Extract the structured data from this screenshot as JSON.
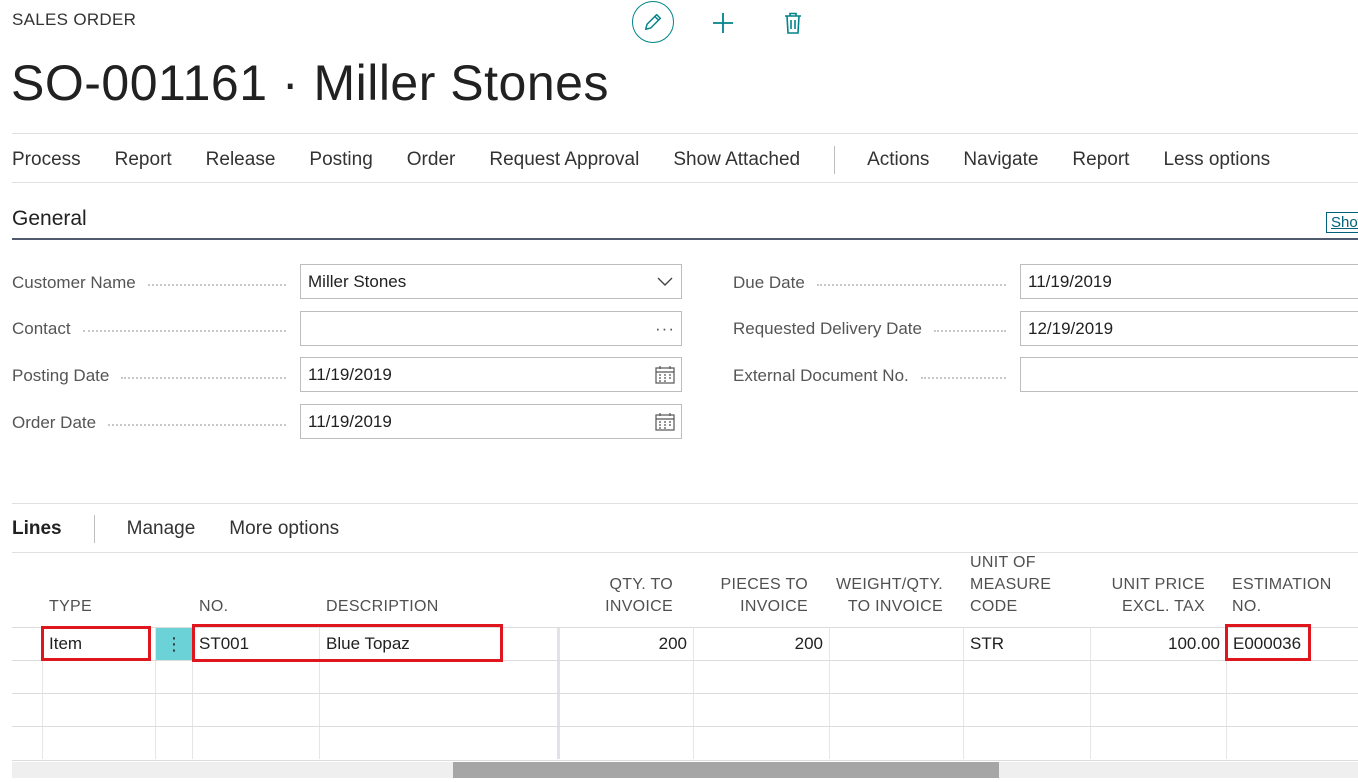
{
  "header": {
    "caption": "SALES ORDER",
    "title": "SO-001161 · Miller Stones",
    "icons": [
      "pencil-icon",
      "plus-icon",
      "trash-icon"
    ]
  },
  "actions": {
    "primary": [
      "Process",
      "Report",
      "Release",
      "Posting",
      "Order",
      "Request Approval",
      "Show Attached"
    ],
    "secondary": [
      "Actions",
      "Navigate",
      "Report",
      "Less options"
    ]
  },
  "general": {
    "title": "General",
    "show_more": "Show",
    "customer_name": {
      "label": "Customer Name",
      "value": "Miller Stones"
    },
    "contact": {
      "label": "Contact",
      "value": ""
    },
    "posting_date": {
      "label": "Posting Date",
      "value": "11/19/2019"
    },
    "order_date": {
      "label": "Order Date",
      "value": "11/19/2019"
    },
    "due_date": {
      "label": "Due Date",
      "value": "11/19/2019"
    },
    "requested_delivery_date": {
      "label": "Requested Delivery Date",
      "value": "12/19/2019"
    },
    "external_document_no": {
      "label": "External Document No.",
      "value": ""
    }
  },
  "lines": {
    "title": "Lines",
    "actions": [
      "Manage",
      "More options"
    ],
    "headers": {
      "type": "TYPE",
      "no": "NO.",
      "description": "DESCRIPTION",
      "qty_to_invoice": [
        "QTY. TO",
        "INVOICE"
      ],
      "pieces_to_invoice": [
        "PIECES TO",
        "INVOICE"
      ],
      "weight_qty": [
        "WEIGHT/QTY.",
        "TO INVOICE"
      ],
      "uom": [
        "UNIT OF",
        "MEASURE",
        "CODE"
      ],
      "unit_price": [
        "UNIT PRICE",
        "EXCL. TAX"
      ],
      "estimation": [
        "ESTIMATION",
        "NO."
      ]
    },
    "rows": [
      {
        "type": "Item",
        "no": "ST001",
        "description": "Blue Topaz",
        "qty_to_invoice": "200",
        "pieces_to_invoice": "200",
        "weight_qty": "",
        "uom": "STR",
        "unit_price": "100.00",
        "estimation_no": "E000036"
      }
    ]
  },
  "colors": {
    "accent": "#008489",
    "highlight": "#e0161f",
    "selected_row_marker": "#6bd2d8"
  }
}
